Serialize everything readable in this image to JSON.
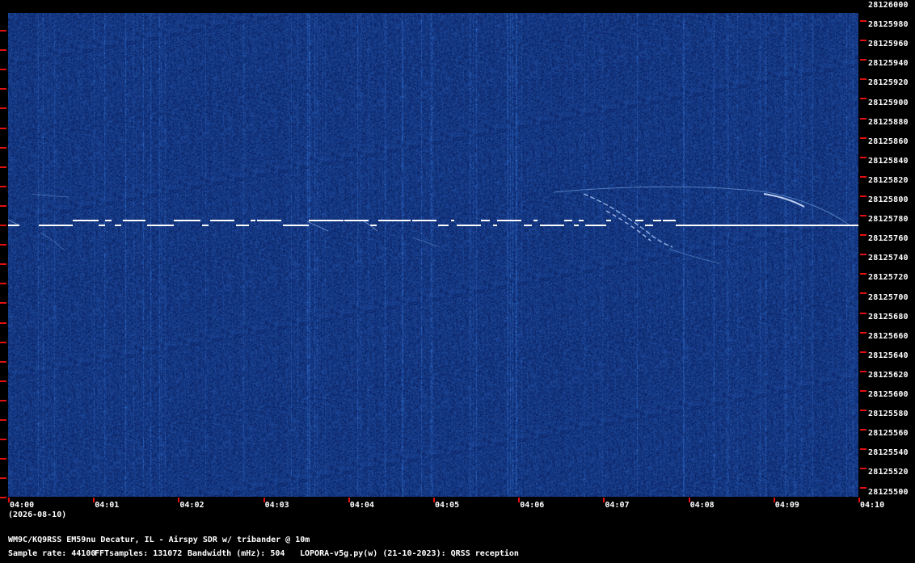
{
  "waterfall": {
    "background_color": "#0c2a66",
    "signal_color": "#ffffff",
    "tick_color": "#e01010"
  },
  "frequency_axis": {
    "labels": [
      "28126000",
      "28125980",
      "28125960",
      "28125940",
      "28125920",
      "28125900",
      "28125880",
      "28125860",
      "28125840",
      "28125820",
      "28125800",
      "28125780",
      "28125760",
      "28125740",
      "28125720",
      "28125700",
      "28125680",
      "28125660",
      "28125640",
      "28125620",
      "28125600",
      "28125580",
      "28125560",
      "28125540",
      "28125520",
      "28125500"
    ]
  },
  "time_axis": {
    "labels": [
      "04:00",
      "04:01",
      "04:02",
      "04:03",
      "04:04",
      "04:05",
      "04:06",
      "04:07",
      "04:08",
      "04:09",
      "04:10"
    ],
    "date": "(2026-08-10)"
  },
  "footer": {
    "station": "WM9C/KQ9RSS EM59nu Decatur, IL - Airspy SDR w/ tribander @ 10m",
    "sample_rate": "Sample rate: 44100",
    "fft_samples": "FFTsamples: 131072",
    "bandwidth": "Bandwidth (mHz): 504",
    "software": "LOPORA-v5g.py(w) (21-10-2023): QRSS reception"
  }
}
